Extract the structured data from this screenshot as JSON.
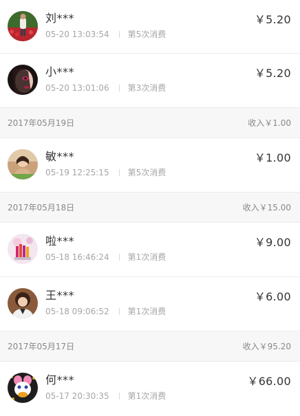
{
  "records": [
    {
      "type": "item",
      "name": "刘***",
      "time": "05-20 13:03:54",
      "count": "第5次消费",
      "amount": "￥5.20",
      "avatar": "avatar-flower-field"
    },
    {
      "type": "item",
      "name": "小***",
      "time": "05-20 13:01:06",
      "count": "第3次消费",
      "amount": "￥5.20",
      "avatar": "avatar-makeup-face"
    },
    {
      "type": "header",
      "date": "2017年05月19日",
      "income": "收入￥1.00"
    },
    {
      "type": "item",
      "name": "敏***",
      "time": "05-19 12:25:15",
      "count": "第5次消费",
      "amount": "￥1.00",
      "avatar": "avatar-woman-portrait"
    },
    {
      "type": "header",
      "date": "2017年05月18日",
      "income": "收入￥15.00"
    },
    {
      "type": "item",
      "name": "啦***",
      "time": "05-18 16:46:24",
      "count": "第1次消费",
      "amount": "￥9.00",
      "avatar": "avatar-lipsticks"
    },
    {
      "type": "item",
      "name": "王***",
      "time": "05-18 09:06:52",
      "count": "第1次消费",
      "amount": "￥6.00",
      "avatar": "avatar-woman-curly"
    },
    {
      "type": "header",
      "date": "2017年05月17日",
      "income": "收入￥95.20"
    },
    {
      "type": "item",
      "name": "何***",
      "time": "05-17 20:30:35",
      "count": "第1次消费",
      "amount": "￥66.00",
      "avatar": "avatar-cartoon-duck"
    }
  ],
  "colors": {
    "text_primary": "#333333",
    "text_secondary": "#a6a6a6",
    "header_bg": "#f7f7f7",
    "divider": "#ececec"
  }
}
